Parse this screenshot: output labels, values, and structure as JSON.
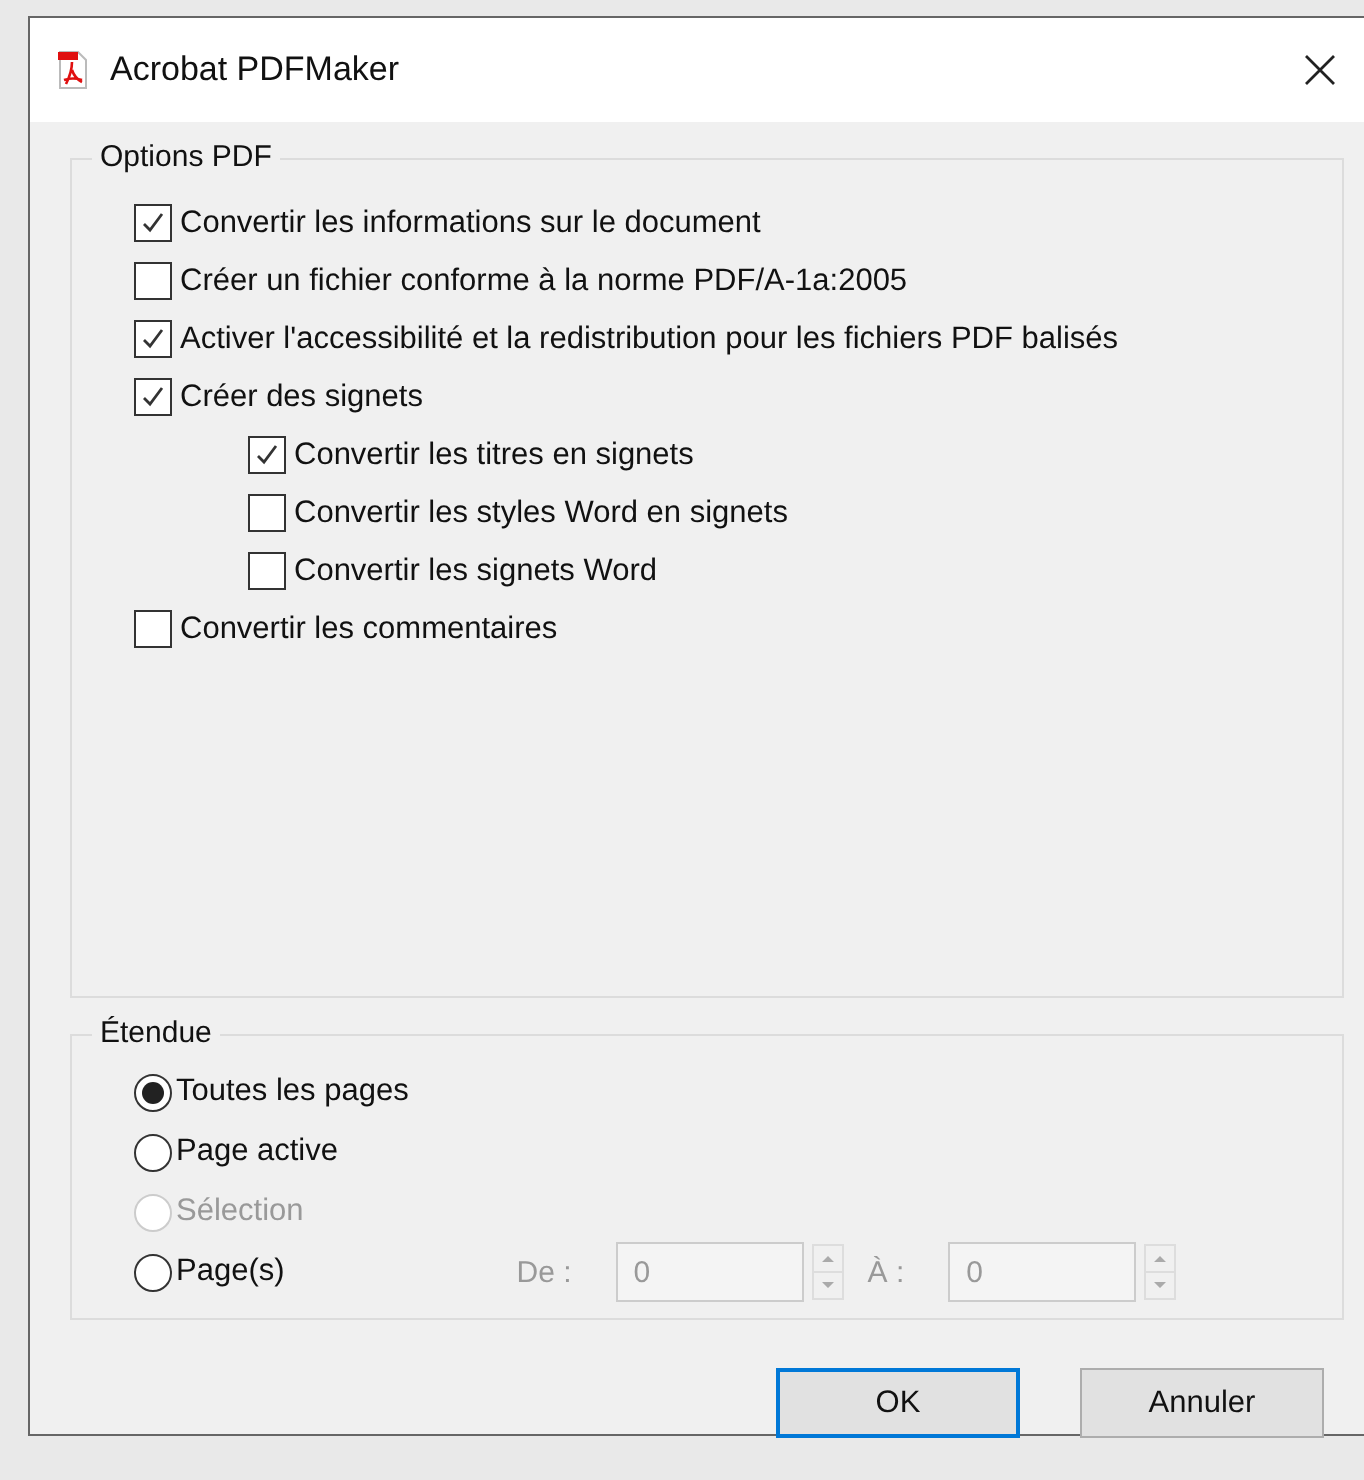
{
  "window": {
    "title": "Acrobat PDFMaker"
  },
  "options_group": {
    "title": "Options PDF",
    "items": [
      {
        "label": "Convertir les informations sur le document",
        "checked": true
      },
      {
        "label": "Créer un fichier conforme à la norme PDF/A-1a:2005",
        "checked": false
      },
      {
        "label": "Activer l'accessibilité et la redistribution pour les fichiers PDF balisés",
        "checked": true
      },
      {
        "label": "Créer des signets",
        "checked": true,
        "children": [
          {
            "label": "Convertir les titres en signets",
            "checked": true
          },
          {
            "label": "Convertir les styles Word en signets",
            "checked": false
          },
          {
            "label": "Convertir les signets Word",
            "checked": false
          }
        ]
      },
      {
        "label": "Convertir les commentaires",
        "checked": false
      }
    ]
  },
  "range_group": {
    "title": "Étendue",
    "options": [
      {
        "label": "Toutes les pages",
        "selected": true,
        "disabled": false
      },
      {
        "label": "Page active",
        "selected": false,
        "disabled": false
      },
      {
        "label": "Sélection",
        "selected": false,
        "disabled": true
      },
      {
        "label": "Page(s)",
        "selected": false,
        "disabled": false
      }
    ],
    "from": {
      "label": "De :",
      "value": "0",
      "disabled": true
    },
    "to": {
      "label": "À :",
      "value": "0",
      "disabled": true
    }
  },
  "buttons": [
    {
      "label": "OK",
      "default": true
    },
    {
      "label": "Annuler",
      "default": false
    }
  ]
}
